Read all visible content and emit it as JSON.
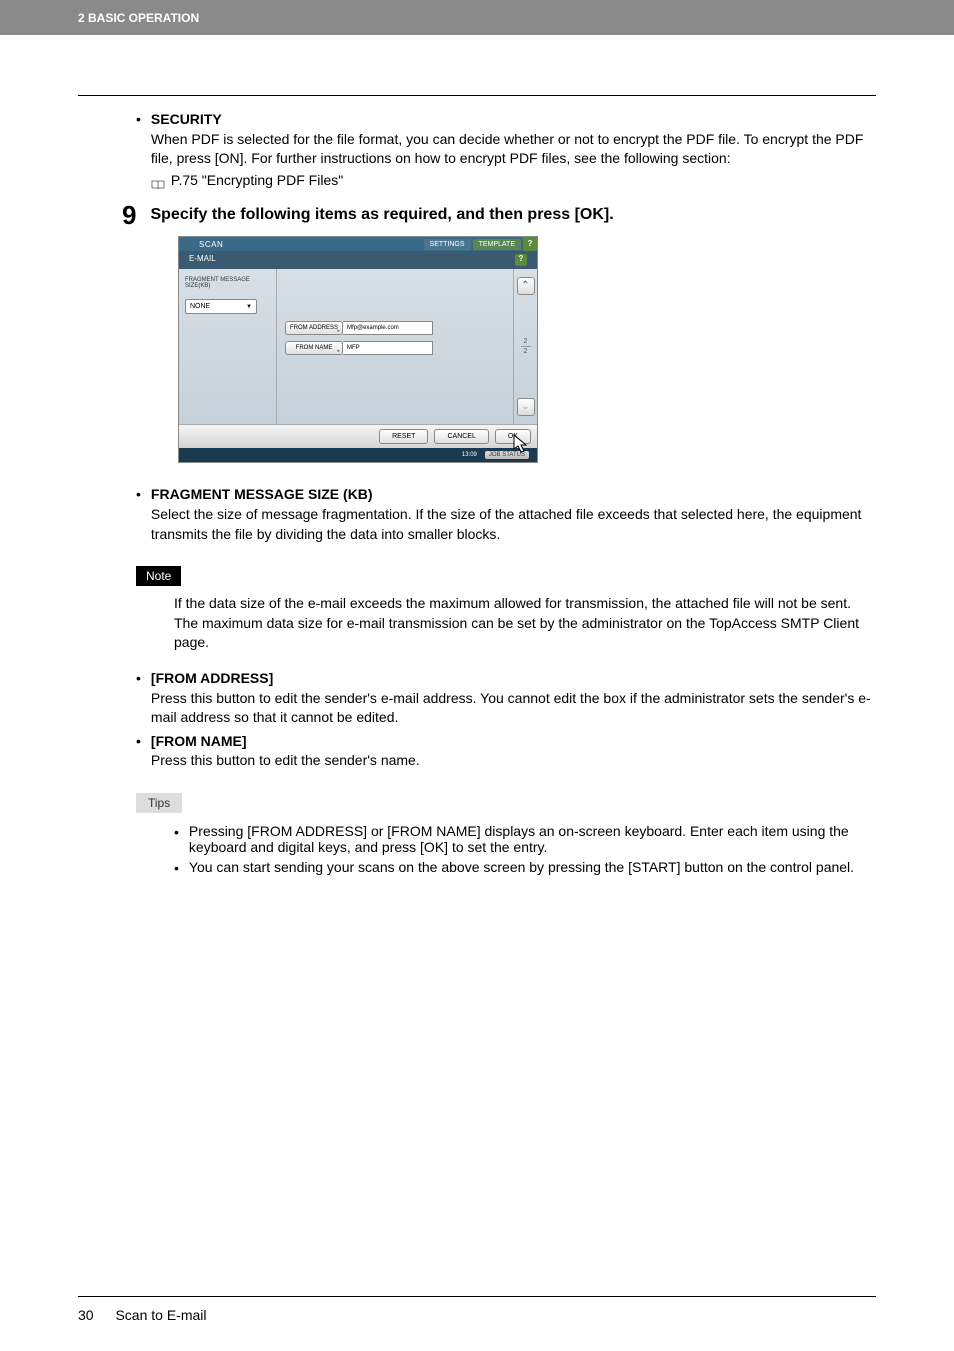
{
  "header": {
    "section": "2 BASIC OPERATION"
  },
  "security": {
    "title": "SECURITY",
    "text": "When PDF is selected for the file format, you can decide whether or not to encrypt the PDF file. To encrypt the PDF file, press [ON]. For further instructions on how to encrypt PDF files, see the following section:",
    "crossref": "P.75 \"Encrypting PDF Files\""
  },
  "step9": {
    "num": "9",
    "title": "Specify the following items as required, and then press [OK]."
  },
  "screen": {
    "title": "SCAN",
    "settings": "SETTINGS",
    "template": "TEMPLATE",
    "subheader": "E-MAIL",
    "help": "?",
    "frag_label": "FRAGMENT MESSAGE SIZE(KB)",
    "frag_value": "NONE",
    "from_addr_label": "FROM ADDRESS",
    "from_addr_value": "Mfp@example.com",
    "from_name_label": "FROM NAME",
    "from_name_value": "MFP",
    "page_top": "2",
    "page_bottom": "2",
    "reset": "RESET",
    "cancel": "CANCEL",
    "ok": "OK",
    "time": "13:09",
    "job_status": "JOB STATUS"
  },
  "fragment": {
    "title": "FRAGMENT MESSAGE SIZE (KB)",
    "text": "Select the size of message fragmentation. If the size of the attached file exceeds that selected here, the equipment transmits the file by dividing the data into smaller blocks."
  },
  "note": {
    "label": "Note",
    "text": "If the data size of the e-mail exceeds the maximum allowed for transmission, the attached file will not be sent. The maximum data size for e-mail transmission can be set by the administrator on the TopAccess SMTP Client page."
  },
  "from_address": {
    "title": "[FROM ADDRESS]",
    "text": "Press this button to edit the sender's e-mail address. You cannot edit the box if the administrator sets the sender's e-mail address so that it cannot be edited."
  },
  "from_name": {
    "title": "[FROM NAME]",
    "text": "Press this button to edit the sender's name."
  },
  "tips": {
    "label": "Tips",
    "tip1": "Pressing [FROM ADDRESS] or [FROM NAME] displays an on-screen keyboard. Enter each item using the keyboard and digital keys, and press [OK] to set the entry.",
    "tip2": "You can start sending your scans on the above screen by pressing the [START] button on the control panel."
  },
  "footer": {
    "page_num": "30",
    "title": "Scan to E-mail"
  }
}
